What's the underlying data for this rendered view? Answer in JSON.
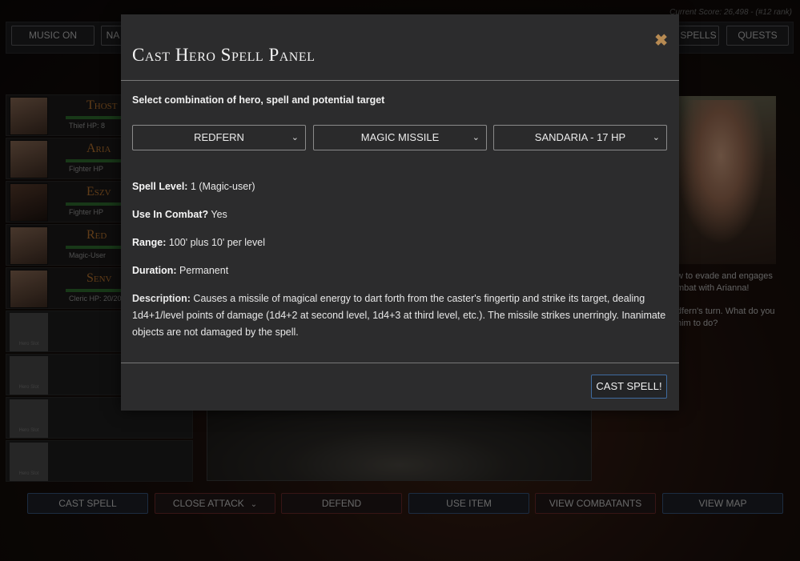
{
  "score": {
    "text": "Current Score: 26,498 - (#12 rank)"
  },
  "topbar": {
    "music_label": "MUSIC ON",
    "nav_label": "NA",
    "spells_label": "SPELLS",
    "quests_label": "QUESTS"
  },
  "party": [
    {
      "name": "Thost",
      "class_hp": "Thief  HP: 8"
    },
    {
      "name": "Aria",
      "class_hp": "Fighter  HP"
    },
    {
      "name": "Eszv",
      "class_hp": "Fighter  HP"
    },
    {
      "name": "Red",
      "class_hp": "Magic-User"
    },
    {
      "name": "Senv",
      "class_hp": "Cleric  HP: 20/20"
    }
  ],
  "empty_slot_label": "Hero Slot",
  "log": {
    "line1": "w to evade and engages\nmbat with Arianna!",
    "line2": "dfern's turn. What do you\nhim to do?"
  },
  "actions": {
    "cast_spell": "CAST SPELL",
    "close_attack": "CLOSE ATTACK",
    "defend": "DEFEND",
    "use_item": "USE ITEM",
    "view_combatants": "VIEW COMBATANTS",
    "view_map": "VIEW MAP"
  },
  "modal": {
    "title": "Cast Hero Spell Panel",
    "close_glyph": "✖",
    "instruction": "Select combination of hero, spell and potential target",
    "hero_select": "REDFERN",
    "spell_select": "MAGIC MISSILE",
    "target_select": "SANDARIA - 17 HP",
    "spell_level_label": "Spell Level:",
    "spell_level_value": " 1 (Magic-user)",
    "combat_label": "Use In Combat?",
    "combat_value": " Yes",
    "range_label": "Range:",
    "range_value": " 100' plus 10' per level",
    "duration_label": "Duration:",
    "duration_value": " Permanent",
    "description_label": "Description:",
    "description_value": " Causes a missile of magical energy to dart forth from the caster's fingertip and strike its target, dealing 1d4+1/level points of damage (1d4+2 at second level, 1d4+3 at third level, etc.). The missile strikes unerringly. Inanimate objects are not damaged by the spell.",
    "cast_button": "CAST SPELL!"
  },
  "colors": {
    "accent_blue": "#3f6ba0",
    "close_icon": "#b78a52",
    "hero_name": "#b8732e"
  }
}
